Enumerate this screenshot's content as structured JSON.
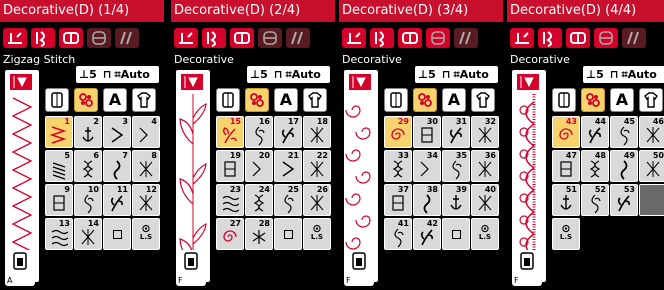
{
  "screens": [
    {
      "title": "Decorative(D) (1/4)",
      "mode_label": "Zigzag Stitch",
      "pattern": "zigzag",
      "foot_label": "A",
      "selected_category": 1,
      "cells": [
        {
          "num": "1",
          "sel": true,
          "glyph": "zigzag"
        },
        {
          "num": "2",
          "glyph": "anchor"
        },
        {
          "num": "3",
          "glyph": "chevron"
        },
        {
          "num": "4",
          "glyph": "chevron2"
        },
        {
          "num": "5",
          "glyph": "ladder"
        },
        {
          "num": "6",
          "glyph": "braid"
        },
        {
          "num": "7",
          "glyph": "leaf"
        },
        {
          "num": "8",
          "glyph": "cross"
        },
        {
          "num": "9",
          "glyph": "box"
        },
        {
          "num": "10",
          "glyph": "vine"
        },
        {
          "num": "11",
          "glyph": "leaf2"
        },
        {
          "num": "12",
          "glyph": "cross"
        },
        {
          "num": "13",
          "glyph": "wave"
        },
        {
          "num": "14",
          "glyph": "cross"
        },
        {
          "num": "",
          "glyph": "btn-sq"
        },
        {
          "num": "",
          "glyph": "btn-ls"
        }
      ]
    },
    {
      "title": "Decorative(D) (2/4)",
      "mode_label": "Decorative",
      "pattern": "flower",
      "foot_label": "F",
      "selected_category": 1,
      "cells": [
        {
          "num": "15",
          "sel": true,
          "glyph": "flower"
        },
        {
          "num": "16",
          "glyph": "vine"
        },
        {
          "num": "17",
          "glyph": "leaf2"
        },
        {
          "num": "18",
          "glyph": "cross"
        },
        {
          "num": "19",
          "glyph": "box"
        },
        {
          "num": "20",
          "glyph": "chevron2"
        },
        {
          "num": "21",
          "glyph": "chevron"
        },
        {
          "num": "22",
          "glyph": "cross"
        },
        {
          "num": "23",
          "glyph": "wave"
        },
        {
          "num": "24",
          "glyph": "braid"
        },
        {
          "num": "25",
          "glyph": "vine"
        },
        {
          "num": "26",
          "glyph": "cross"
        },
        {
          "num": "27",
          "glyph": "spiral"
        },
        {
          "num": "28",
          "glyph": "snow"
        },
        {
          "num": "",
          "glyph": "btn-sq"
        },
        {
          "num": "",
          "glyph": "btn-ls"
        }
      ]
    },
    {
      "title": "Decorative(D) (3/4)",
      "mode_label": "Decorative",
      "pattern": "scroll",
      "foot_label": "F",
      "selected_category": 1,
      "cells": [
        {
          "num": "29",
          "sel": true,
          "glyph": "spiral"
        },
        {
          "num": "30",
          "glyph": "box"
        },
        {
          "num": "31",
          "glyph": "leaf2"
        },
        {
          "num": "32",
          "glyph": "cross"
        },
        {
          "num": "33",
          "glyph": "braid"
        },
        {
          "num": "34",
          "glyph": "chevron2"
        },
        {
          "num": "35",
          "glyph": "vine"
        },
        {
          "num": "36",
          "glyph": "cross"
        },
        {
          "num": "37",
          "glyph": "box"
        },
        {
          "num": "38",
          "glyph": "leaf"
        },
        {
          "num": "39",
          "glyph": "anchor"
        },
        {
          "num": "40",
          "glyph": "cross"
        },
        {
          "num": "41",
          "glyph": "vine"
        },
        {
          "num": "42",
          "glyph": "leaf2"
        },
        {
          "num": "",
          "glyph": "btn-sq"
        },
        {
          "num": "",
          "glyph": "btn-ls"
        }
      ]
    },
    {
      "title": "Decorative(D) (4/4)",
      "mode_label": "Decorative",
      "pattern": "scallop",
      "foot_label": "F",
      "selected_category": 1,
      "cells": [
        {
          "num": "43",
          "sel": true,
          "glyph": "spiral"
        },
        {
          "num": "44",
          "glyph": "leaf2"
        },
        {
          "num": "45",
          "glyph": "vine"
        },
        {
          "num": "46",
          "glyph": "cross"
        },
        {
          "num": "47",
          "glyph": "box"
        },
        {
          "num": "48",
          "glyph": "braid"
        },
        {
          "num": "49",
          "glyph": "leaf"
        },
        {
          "num": "50",
          "glyph": "cross"
        },
        {
          "num": "51",
          "glyph": "anchor"
        },
        {
          "num": "52",
          "glyph": "vine"
        },
        {
          "num": "53",
          "glyph": "leaf2"
        },
        {
          "num": "",
          "glyph": "empty"
        },
        {
          "num": "",
          "glyph": "btn-ls"
        }
      ]
    }
  ],
  "controls": {
    "pressure_label": "5",
    "auto_label": "Auto"
  },
  "categories": [
    {
      "icon": "bobbin-icon"
    },
    {
      "icon": "decorative-flower-icon"
    },
    {
      "icon": "letter-a-icon"
    },
    {
      "icon": "shirt-icon"
    }
  ],
  "mode_icons": [
    "straight-stitch-icon",
    "decorative-icon",
    "buttonhole-icon",
    "quilt-icon",
    "satin-icon"
  ],
  "colors": {
    "brand_red": "#c8102e",
    "selected_yellow": "#f7d36d",
    "cell_grey": "#d9d9d9"
  }
}
